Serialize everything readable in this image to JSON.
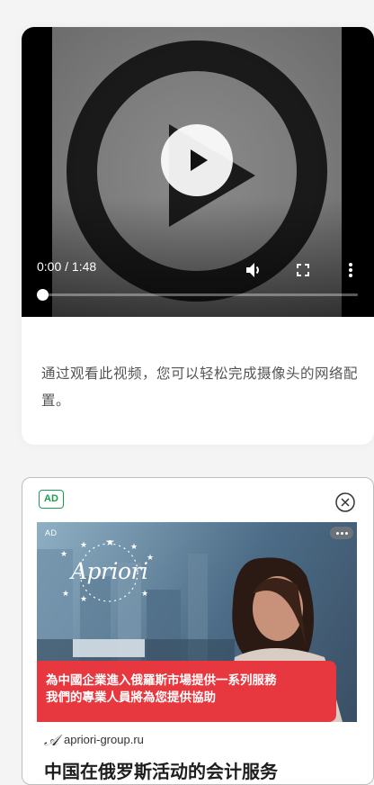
{
  "video": {
    "time_display": "0:00 / 1:48",
    "progress_fraction": 0.0,
    "caption": "通过观看此视频，您可以轻松完成摄像头的网络配置。"
  },
  "ad": {
    "badge": "AD",
    "image_corner_label": "AD",
    "brand_name": "Apriori",
    "banner_line1": "為中國企業進入俄羅斯市場提供一系列服務",
    "banner_line2": "我們的專業人員將為您提供協助",
    "source_icon": "𝒜",
    "source_domain": "apriori-group.ru",
    "headline": "中国在俄罗斯活动的会计服务"
  },
  "icons": {
    "play": "play-icon",
    "volume": "volume-icon",
    "fullscreen": "fullscreen-icon",
    "more": "more-vertical-icon",
    "close": "close-circle-icon",
    "ad_menu": "more-horizontal-icon"
  },
  "colors": {
    "ad_badge_green": "#1a9d50",
    "banner_red": "#e8383f",
    "page_background": "#f4f4f5"
  }
}
